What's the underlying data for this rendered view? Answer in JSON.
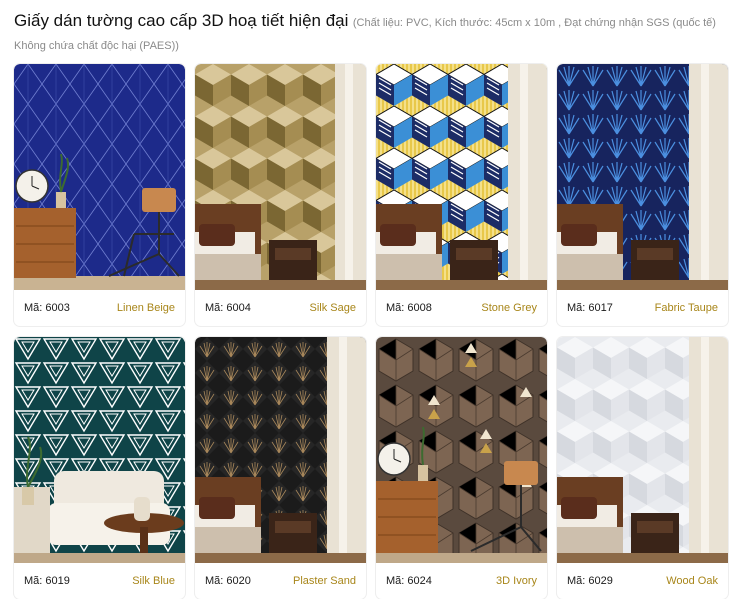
{
  "header": {
    "title": "Giấy dán tường cao cấp 3D hoạ tiết hiện đại",
    "subtitle": "(Chất liệu: PVC, Kích thước: 45cm x 10m , Đạt chứng nhận SGS (quốc tế) Không chứa chất độc hại (PAES))"
  },
  "accent_color": "#a8861a",
  "products": [
    {
      "code": "Mã: 6003",
      "name": "Linen Beige",
      "pattern": "navy-diamond-lattice",
      "scene": "cabinet-chair"
    },
    {
      "code": "Mã: 6004",
      "name": "Silk Sage",
      "pattern": "olive-3d-cubes",
      "scene": "bedroom"
    },
    {
      "code": "Mã: 6008",
      "name": "Stone Grey",
      "pattern": "blue-yellow-striped-cubes",
      "scene": "bedroom"
    },
    {
      "code": "Mã: 6017",
      "name": "Fabric Taupe",
      "pattern": "navy-fan-motif",
      "scene": "bedroom"
    },
    {
      "code": "Mã: 6019",
      "name": "Silk Blue",
      "pattern": "teal-triangles",
      "scene": "living-room"
    },
    {
      "code": "Mã: 6020",
      "name": "Plaster Sand",
      "pattern": "black-gold-fans",
      "scene": "bedroom"
    },
    {
      "code": "Mã: 6024",
      "name": "3D Ivory",
      "pattern": "wood-hexagon-stars",
      "scene": "cabinet-chair"
    },
    {
      "code": "Mã: 6029",
      "name": "Wood Oak",
      "pattern": "white-3d-cubes",
      "scene": "bedroom"
    }
  ]
}
